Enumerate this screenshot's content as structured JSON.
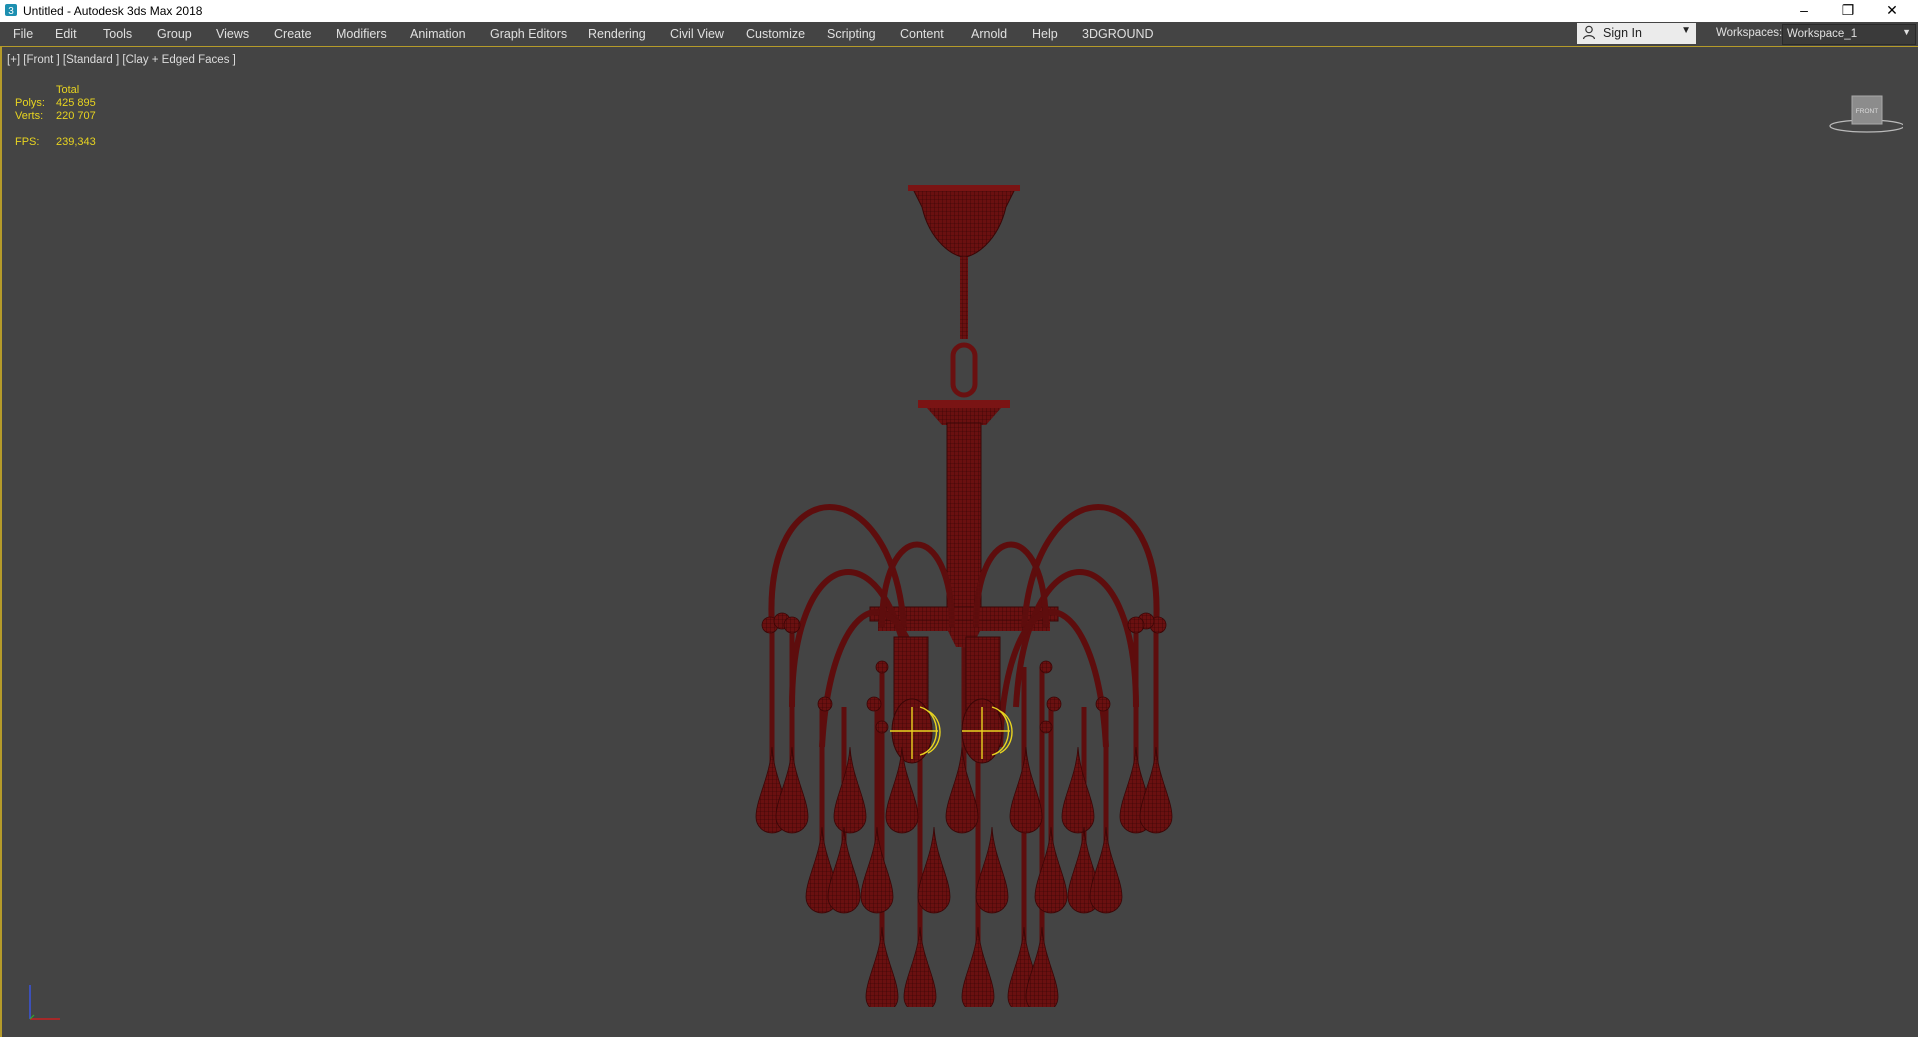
{
  "window": {
    "title": "Untitled - Autodesk 3ds Max 2018",
    "controls": {
      "minimize": "–",
      "restore": "❐",
      "close": "✕"
    }
  },
  "menu": {
    "items": [
      "File",
      "Edit",
      "Tools",
      "Group",
      "Views",
      "Create",
      "Modifiers",
      "Animation",
      "Graph Editors",
      "Rendering",
      "Civil View",
      "Customize",
      "Scripting",
      "Content",
      "Arnold",
      "Help",
      "3DGROUND"
    ]
  },
  "account": {
    "sign_in_label": "Sign In"
  },
  "workspaces": {
    "label": "Workspaces:",
    "value": "Workspace_1"
  },
  "viewport": {
    "label": "[+] [Front ] [Standard ] [Clay + Edged Faces ]",
    "stats": {
      "total_label": "Total",
      "polys_label": "Polys:",
      "polys_value": "425 895",
      "verts_label": "Verts:",
      "verts_value": "220 707",
      "fps_label": "FPS:",
      "fps_value": "239,343"
    },
    "viewcube_face": "FRONT"
  },
  "colors": {
    "accent": "#b59b2a",
    "stats_text": "#e8d420",
    "mesh": "#7a1414",
    "background": "#444444"
  }
}
